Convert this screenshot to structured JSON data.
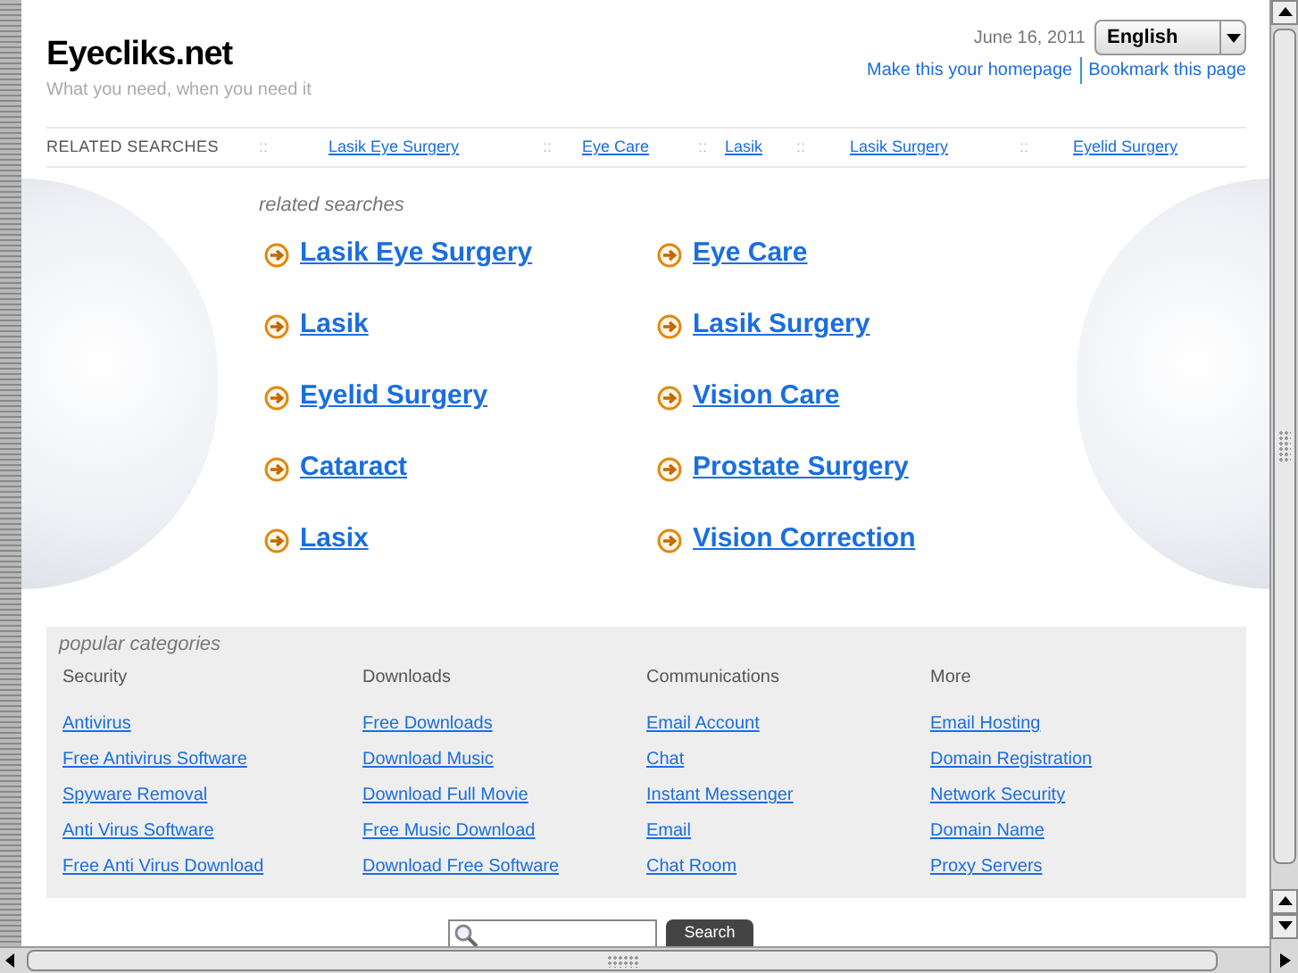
{
  "header": {
    "site_title": "Eyecliks.net",
    "tagline": "What you need, when you need it",
    "date": "June 16, 2011",
    "language": "English",
    "links": [
      "Make this your homepage",
      "Bookmark this page"
    ]
  },
  "related_bar": {
    "label": "RELATED SEARCHES",
    "separator": "::",
    "links": [
      "Lasik Eye Surgery",
      "Eye Care",
      "Lasik",
      "Lasik Surgery",
      "Eyelid Surgery"
    ]
  },
  "related_searches": {
    "title": "related searches",
    "items": [
      "Lasik Eye Surgery",
      "Eye Care",
      "Lasik",
      "Lasik Surgery",
      "Eyelid Surgery",
      "Vision Care",
      "Cataract",
      "Prostate Surgery",
      "Lasix",
      "Vision Correction"
    ]
  },
  "popular_categories": {
    "title": "popular categories",
    "columns": [
      {
        "heading": "Security",
        "links": [
          "Antivirus",
          "Free Antivirus Software",
          "Spyware Removal",
          "Anti Virus Software",
          "Free Anti Virus Download"
        ]
      },
      {
        "heading": "Downloads",
        "links": [
          "Free Downloads",
          "Download Music",
          "Download Full Movie",
          "Free Music Download",
          "Download Free Software"
        ]
      },
      {
        "heading": "Communications",
        "links": [
          "Email Account",
          "Chat",
          "Instant Messenger",
          "Email",
          "Chat Room"
        ]
      },
      {
        "heading": "More",
        "links": [
          "Email Hosting",
          "Domain Registration",
          "Network Security",
          "Domain Name",
          "Proxy Servers"
        ]
      }
    ]
  },
  "search": {
    "button": "Search"
  }
}
